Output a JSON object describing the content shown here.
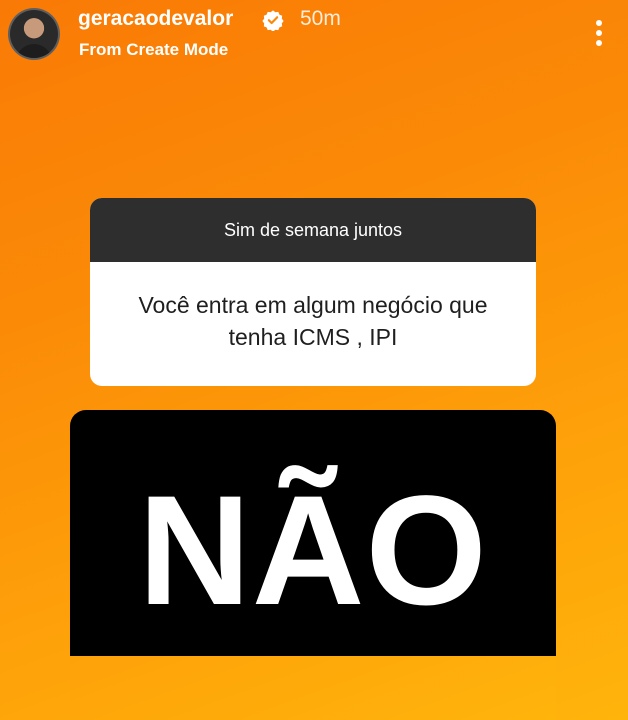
{
  "header": {
    "username": "geracaodevalor",
    "time": "50m",
    "subtitle": "From Create Mode",
    "icons": {
      "avatar": "profile-avatar",
      "verified": "verified-badge-icon",
      "more": "more-options-icon"
    }
  },
  "question_sticker": {
    "prompt": "Sim de semana juntos",
    "question": "Você entra em algum negócio que tenha ICMS , IPI"
  },
  "answer": {
    "text": "NÃO"
  },
  "colors": {
    "background_top": "#f97a06",
    "background_bottom": "#ffb40b",
    "sticker_header": "#2e2e2e",
    "answer_box": "#000000"
  }
}
